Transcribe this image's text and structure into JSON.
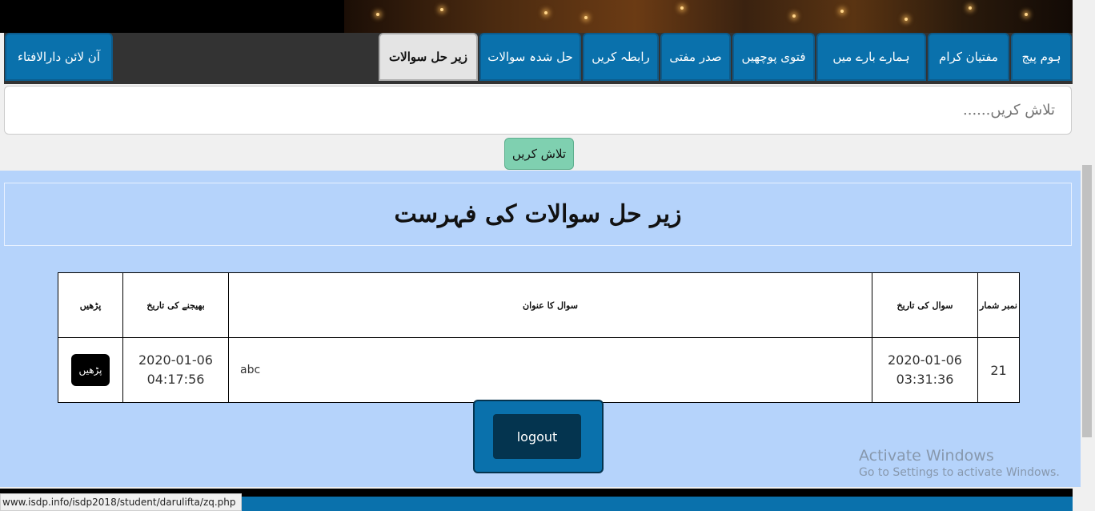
{
  "nav": {
    "tabs": [
      {
        "label": "ہوم پیج"
      },
      {
        "label": "مفتیان کرام"
      },
      {
        "label": "ہمارے بارے میں"
      },
      {
        "label": "فتوی پوچھیں"
      },
      {
        "label": "صدر مفتی"
      },
      {
        "label": "رابطہ کریں"
      },
      {
        "label": "حل شدہ سوالات"
      },
      {
        "label": "زیر حل سوالات"
      }
    ],
    "brand": "آن لائن دارالافتاء"
  },
  "search": {
    "placeholder": "تلاش کریں......",
    "value": "",
    "button_label": "تلاش کریں"
  },
  "page": {
    "title": "زیر حل سوالات کی فہرست"
  },
  "table": {
    "headers": [
      "نمبر شمار",
      "سوال کی تاریخ",
      "سوال کا عنوان",
      "بھیجنے کی تاریخ",
      "پڑھیں"
    ],
    "rows": [
      {
        "serial": "21",
        "question_date": "2020-01-06",
        "question_time": "03:31:36",
        "title": "abc",
        "sent_date": "2020-01-06",
        "sent_time": "04:17:56",
        "read_label": "پڑھیں"
      }
    ]
  },
  "logout_label": "logout",
  "windows_notice": {
    "line1": "Activate Windows",
    "line2": "Go to Settings to activate Windows."
  },
  "status_url": "www.isdp.info/isdp2018/student/darulifta/zq.php"
}
